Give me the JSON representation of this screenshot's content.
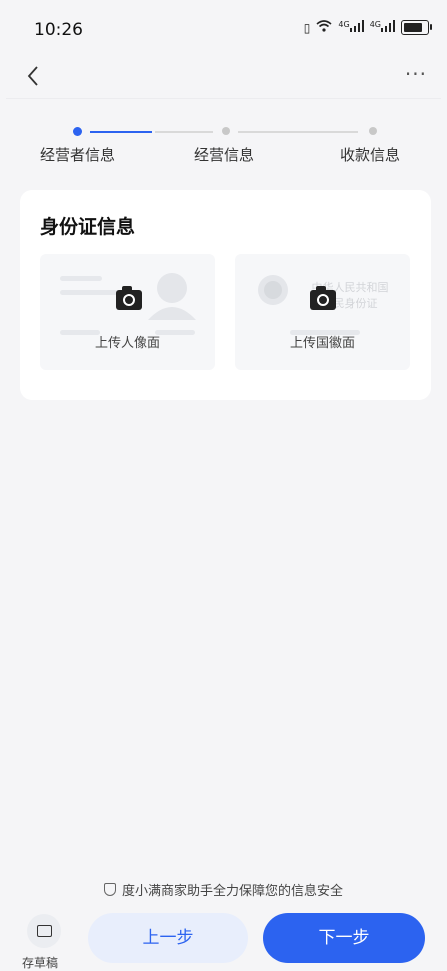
{
  "status_bar": {
    "time": "10:26",
    "icons": [
      "vibrate-icon",
      "wifi-icon",
      "signal-4g-icon",
      "signal-4g-icon",
      "battery-icon"
    ],
    "network_label_1": "4G",
    "network_label_2": "4G"
  },
  "nav": {
    "back_icon": "‹",
    "more_icon": "···"
  },
  "stepper": {
    "steps": [
      {
        "label": "经营者信息",
        "state": "active"
      },
      {
        "label": "经营信息",
        "state": "pending"
      },
      {
        "label": "收款信息",
        "state": "pending"
      }
    ],
    "active_color": "#2c63f0",
    "pending_color": "#c8c8c8"
  },
  "id_card": {
    "title": "身份证信息",
    "front": {
      "label": "上传人像面",
      "icon": "camera-icon"
    },
    "back": {
      "label": "上传国徽面",
      "icon": "camera-icon",
      "watermark_line1": "中华人民共和国",
      "watermark_line2": "居民身份证"
    }
  },
  "footer": {
    "notice": "度小满商家助手全力保障您的信息安全",
    "draft_label": "存草稿",
    "prev_label": "上一步",
    "next_label": "下一步"
  },
  "colors": {
    "accent": "#2c63f0",
    "background": "#f5f5f7",
    "card": "#ffffff"
  }
}
